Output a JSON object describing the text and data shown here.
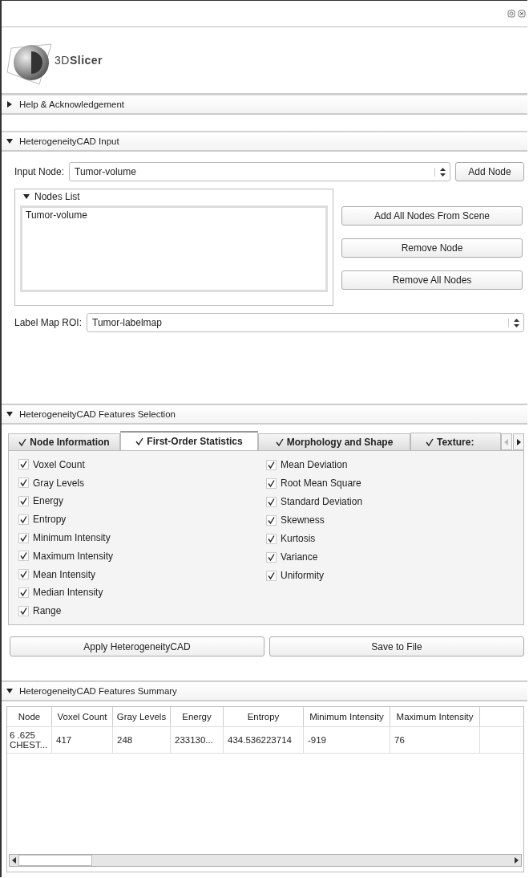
{
  "logo": {
    "text": "3D**Slicer**"
  },
  "help": {
    "title": "Help & Acknowledgement",
    "expanded": false
  },
  "input": {
    "title": "HeterogeneityCAD Input",
    "expanded": true,
    "input_node": {
      "label": "Input Node:",
      "value": "Tumor-volume",
      "button": "Add Node"
    },
    "nodes_list": {
      "title": "Nodes List",
      "expanded": true,
      "items": [
        {
          "label": "Tumor-volume",
          "selected": false
        }
      ]
    },
    "buttons": [
      "Add All Nodes From Scene",
      "Remove Node",
      "Remove All Nodes"
    ],
    "label_map": {
      "label": "Label Map ROI:",
      "value": "Tumor-labelmap"
    }
  },
  "features": {
    "title": "HeterogeneityCAD Features Selection",
    "expanded": true,
    "tabs": [
      {
        "label": "Node Information",
        "checked": true,
        "selected": false
      },
      {
        "label": "First-Order Statistics",
        "checked": true,
        "selected": true
      },
      {
        "label": "Morphology and Shape",
        "checked": true,
        "selected": false
      },
      {
        "label": "Texture:",
        "checked": true,
        "selected": false
      }
    ],
    "columns": [
      [
        {
          "label": "Voxel Count",
          "checked": true
        },
        {
          "label": "Gray Levels",
          "checked": true
        },
        {
          "label": "Energy",
          "checked": true
        },
        {
          "label": "Entropy",
          "checked": true
        },
        {
          "label": "Minimum Intensity",
          "checked": true
        },
        {
          "label": "Maximum Intensity",
          "checked": true
        },
        {
          "label": "Mean Intensity",
          "checked": true
        },
        {
          "label": "Median Intensity",
          "checked": true
        },
        {
          "label": "Range",
          "checked": true
        }
      ],
      [
        {
          "label": "Mean Deviation",
          "checked": true
        },
        {
          "label": "Root Mean Square",
          "checked": true
        },
        {
          "label": "Standard Deviation",
          "checked": true
        },
        {
          "label": "Skewness",
          "checked": true
        },
        {
          "label": "Kurtosis",
          "checked": true
        },
        {
          "label": "Variance",
          "checked": true
        },
        {
          "label": "Uniformity",
          "checked": true
        }
      ]
    ],
    "buttons": [
      "Apply HeterogeneityCAD",
      "Save to File"
    ]
  },
  "summary": {
    "title": "HeterogeneityCAD Features Summary",
    "expanded": true,
    "columns": [
      "Node",
      "Voxel Count",
      "Gray Levels",
      "Energy",
      "Entropy",
      "Minimum Intensity",
      "Maximum Intensity"
    ],
    "rows": [
      [
        "6 .625 CHEST...",
        "417",
        "248",
        "233130...",
        "434.536223714",
        "-919",
        "76"
      ]
    ]
  }
}
